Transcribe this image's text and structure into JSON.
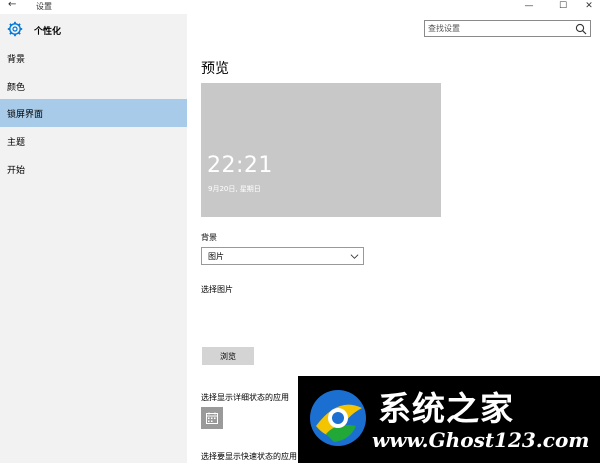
{
  "window": {
    "back_glyph": "←",
    "title": "设置",
    "minimize_glyph": "—",
    "maximize_glyph": "☐",
    "close_glyph": "✕"
  },
  "sidebar": {
    "header_label": "个性化",
    "header_icon": "gear-icon",
    "items": [
      {
        "label": "背景"
      },
      {
        "label": "颜色"
      },
      {
        "label": "锁屏界面",
        "active": true
      },
      {
        "label": "主题"
      },
      {
        "label": "开始"
      }
    ]
  },
  "search": {
    "placeholder": "查找设置"
  },
  "main": {
    "title": "预览",
    "preview": {
      "time": "22:21",
      "date": "9月20日, 星期日"
    },
    "background_label": "背景",
    "background_value": "图片",
    "choose_picture_label": "选择图片",
    "browse_label": "浏览",
    "detailed_status_label": "选择显示详细状态的应用",
    "quick_status_label": "选择要显示快速状态的应用"
  },
  "watermark": {
    "title": "系统之家",
    "url": "www.Ghost123.com"
  },
  "colors": {
    "sidebar_bg": "#f2f2f2",
    "active_item": "#a7cbe9",
    "preview_bg": "#c8c8c8",
    "accent": "#0078d7"
  }
}
